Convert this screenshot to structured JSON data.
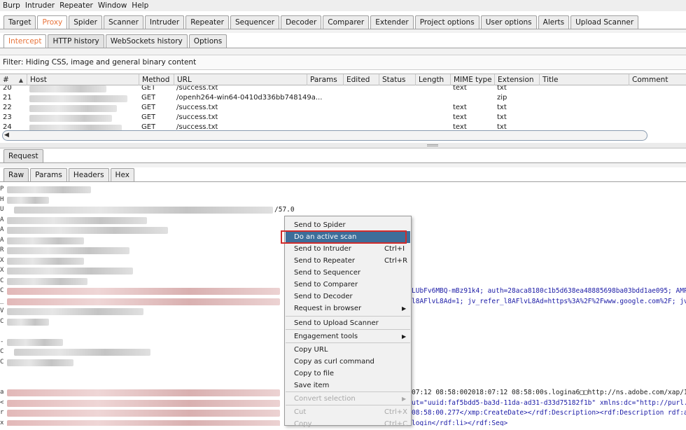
{
  "menu": [
    "Burp",
    "Intruder",
    "Repeater",
    "Window",
    "Help"
  ],
  "main_tabs": [
    "Target",
    "Proxy",
    "Spider",
    "Scanner",
    "Intruder",
    "Repeater",
    "Sequencer",
    "Decoder",
    "Comparer",
    "Extender",
    "Project options",
    "User options",
    "Alerts",
    "Upload Scanner"
  ],
  "main_active": "Proxy",
  "proxy_tabs": [
    "Intercept",
    "HTTP history",
    "WebSockets history",
    "Options"
  ],
  "filter_text": "Filter: Hiding CSS, image and general binary content",
  "table": {
    "columns": [
      "#",
      "Host",
      "Method",
      "URL",
      "Params",
      "Edited",
      "Status",
      "Length",
      "MIME type",
      "Extension",
      "Title",
      "Comment"
    ],
    "rows": [
      {
        "num": "20",
        "method": "GET",
        "url": "/success.txt",
        "mime": "text",
        "ext": "txt"
      },
      {
        "num": "21",
        "method": "GET",
        "url": "/openh264-win64-0410d336bb748149a...",
        "mime": "",
        "ext": "zip"
      },
      {
        "num": "22",
        "method": "GET",
        "url": "/success.txt",
        "mime": "text",
        "ext": "txt"
      },
      {
        "num": "23",
        "method": "GET",
        "url": "/success.txt",
        "mime": "text",
        "ext": "txt"
      },
      {
        "num": "24",
        "method": "GET",
        "url": "/success.txt",
        "mime": "text",
        "ext": "txt"
      }
    ]
  },
  "request_tab": "Request",
  "view_tabs": [
    "Raw",
    "Params",
    "Headers",
    "Hex"
  ],
  "request_lines": [
    {
      "letter": "P",
      "frag": "",
      "blue": false
    },
    {
      "letter": "H",
      "frag": "",
      "blue": false
    },
    {
      "letter": "U",
      "frag": "/57.0",
      "blue": false
    },
    {
      "letter": "A",
      "frag": "",
      "blue": false
    },
    {
      "letter": "A",
      "frag": "",
      "blue": false
    },
    {
      "letter": "A",
      "frag": "",
      "blue": false
    },
    {
      "letter": "R",
      "frag": "",
      "blue": false
    },
    {
      "letter": "X",
      "frag": "",
      "blue": false
    },
    {
      "letter": "X",
      "frag": "",
      "blue": false
    },
    {
      "letter": "C",
      "frag": "",
      "blue": false
    },
    {
      "letter": "C",
      "frag": "LUbFv6MBQ-mBz91k4; auth=28aca8180c1b5d638ea48885698ba03bdd1ae095; AMP_TOK",
      "blue": true
    },
    {
      "letter": "_",
      "frag": "l8AFlvL8Ad=1; jv_refer_l8AFlvL8Ad=https%3A%2F%2Fwww.google.com%2F; jv_utm_",
      "blue": true
    },
    {
      "letter": "V",
      "frag": "",
      "blue": false
    },
    {
      "letter": "C",
      "frag": "",
      "blue": false
    },
    {
      "letter": "",
      "frag": "",
      "blue": false
    },
    {
      "letter": "-",
      "frag": "",
      "blue": false
    },
    {
      "letter": "C",
      "frag": "",
      "blue": false
    },
    {
      "letter": "C",
      "frag": "",
      "blue": false
    },
    {
      "letter": "",
      "frag": "",
      "blue": false
    },
    {
      "letter": "",
      "frag": "",
      "blue": false
    },
    {
      "letter": "a",
      "frag": "07:12 08:58:002018:07:12 08:58:00s.logina6□□http://ns.adobe.com/xap/1.0/<?xpacket beg",
      "blue": false
    },
    {
      "letter": "<",
      "frag": "ut=\"uuid:faf5bdd5-ba3d-11da-ad31-d33d75182f1b\" xmlns:dc=\"http://purl.org/dc/elements/",
      "blue": true
    },
    {
      "letter": "r",
      "frag": "08:58:00.277</xmp:CreateDate></rdf:Description><rdf:Description rdf:about=\"uuid:faf5bdd",
      "blue": true
    },
    {
      "letter": "x",
      "frag": "login</rdf:li></rdf:Seq>",
      "blue": true
    },
    {
      "letter": "",
      "frag": "",
      "blue": false
    }
  ],
  "context_menu": [
    {
      "label": "Send to Spider",
      "shortcut": "",
      "submenu": false,
      "highlight": false,
      "disabled": false
    },
    {
      "label": "Do an active scan",
      "shortcut": "",
      "submenu": false,
      "highlight": true,
      "disabled": false
    },
    {
      "label": "Send to Intruder",
      "shortcut": "Ctrl+I",
      "submenu": false,
      "highlight": false,
      "disabled": false
    },
    {
      "label": "Send to Repeater",
      "shortcut": "Ctrl+R",
      "submenu": false,
      "highlight": false,
      "disabled": false
    },
    {
      "label": "Send to Sequencer",
      "shortcut": "",
      "submenu": false,
      "highlight": false,
      "disabled": false
    },
    {
      "label": "Send to Comparer",
      "shortcut": "",
      "submenu": false,
      "highlight": false,
      "disabled": false
    },
    {
      "label": "Send to Decoder",
      "shortcut": "",
      "submenu": false,
      "highlight": false,
      "disabled": false
    },
    {
      "label": "Request in browser",
      "shortcut": "",
      "submenu": true,
      "highlight": false,
      "disabled": false
    },
    {
      "label": "Send to Upload Scanner",
      "shortcut": "",
      "submenu": false,
      "highlight": false,
      "disabled": false
    },
    {
      "label": "Engagement tools",
      "shortcut": "",
      "submenu": true,
      "highlight": false,
      "disabled": false
    },
    {
      "label": "Copy URL",
      "shortcut": "",
      "submenu": false,
      "highlight": false,
      "disabled": false
    },
    {
      "label": "Copy as curl command",
      "shortcut": "",
      "submenu": false,
      "highlight": false,
      "disabled": false
    },
    {
      "label": "Copy to file",
      "shortcut": "",
      "submenu": false,
      "highlight": false,
      "disabled": false
    },
    {
      "label": "Save item",
      "shortcut": "",
      "submenu": false,
      "highlight": false,
      "disabled": false
    },
    {
      "label": "Convert selection",
      "shortcut": "",
      "submenu": true,
      "highlight": false,
      "disabled": true
    },
    {
      "label": "Cut",
      "shortcut": "Ctrl+X",
      "submenu": false,
      "highlight": false,
      "disabled": true
    },
    {
      "label": "Copy",
      "shortcut": "Ctrl+C",
      "submenu": false,
      "highlight": false,
      "disabled": true
    }
  ]
}
